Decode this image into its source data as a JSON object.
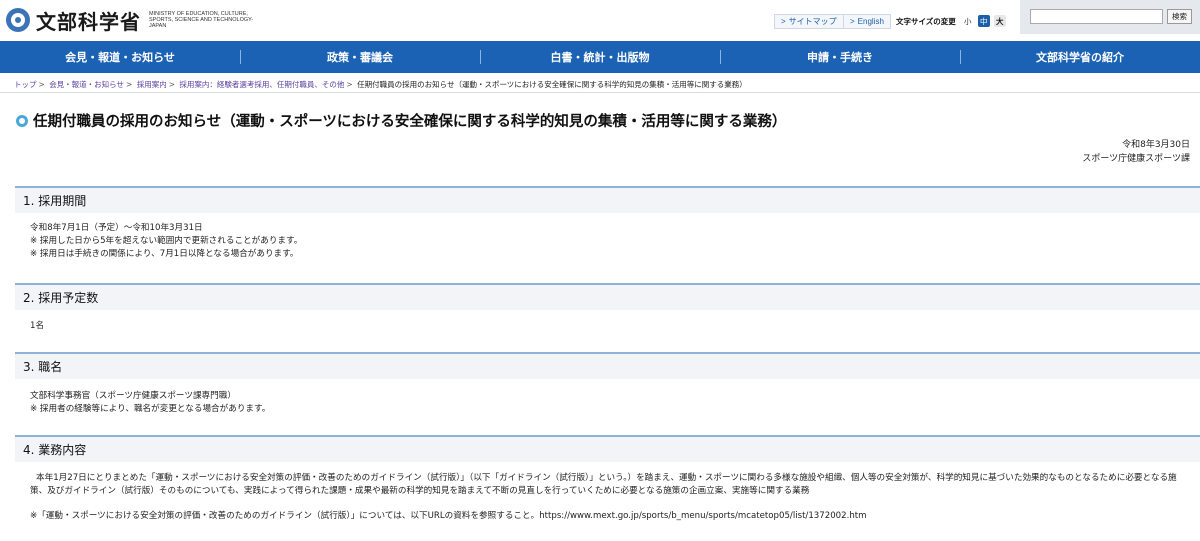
{
  "header": {
    "logo_text": "文部科学省",
    "logo_en": "MINISTRY OF EDUCATION, CULTURE, SPORTS, SCIENCE AND TECHNOLOGY-JAPAN",
    "sitemap_label": "サイトマップ",
    "english_label": "English",
    "fontsize_label": "文字サイズの変更",
    "fontsize_small": "小",
    "fontsize_mid": "中",
    "fontsize_big": "大",
    "search_placeholder": "",
    "search_button": "検索"
  },
  "nav": {
    "items": [
      {
        "label": "会見・報道・お知らせ"
      },
      {
        "label": "政策・審議会"
      },
      {
        "label": "白書・統計・出版物"
      },
      {
        "label": "申請・手続き"
      },
      {
        "label": "文部科学省の紹介"
      }
    ]
  },
  "breadcrumb": {
    "items": [
      {
        "label": "トップ"
      },
      {
        "label": "会見・報道・お知らせ"
      },
      {
        "label": "採用案内"
      },
      {
        "label": "採用案内：経験者選考採用、任期付職員、その他"
      }
    ],
    "current": "任期付職員の採用のお知らせ（運動・スポーツにおける安全確保に関する科学的知見の集積・活用等に関する業務）"
  },
  "page": {
    "title": "任期付職員の採用のお知らせ（運動・スポーツにおける安全確保に関する科学的知見の集積・活用等に関する業務）",
    "date": "令和8年3月30日",
    "department": "スポーツ庁健康スポーツ課"
  },
  "sections": [
    {
      "heading": "1. 採用期間",
      "lines": [
        "令和8年7月1日（予定）～令和10年3月31日",
        "※ 採用した日から5年を超えない範囲内で更新されることがあります。",
        "※ 採用日は手続きの関係により、7月1日以降となる場合があります。"
      ]
    },
    {
      "heading": "2. 採用予定数",
      "lines": [
        "1名"
      ]
    },
    {
      "heading": "3. 職名",
      "lines": [
        "文部科学事務官（スポーツ庁健康スポーツ課専門職）",
        "※ 採用者の経験等により、職名が変更となる場合があります。"
      ]
    },
    {
      "heading": "4. 業務内容",
      "paragraph": "本年1月27日にとりまとめた「運動・スポーツにおける安全対策の評価・改善のためのガイドライン（試行版）」（以下「ガイドライン（試行版）」という。）を踏まえ、運動・スポーツに関わる多様な施設や組織、個人等の安全対策が、科学的知見に基づいた効果的なものとなるために必要となる施策、及びガイドライン（試行版）そのものについても、実践によって得られた課題・成果や最新の科学的知見を踏まえて不断の見直しを行っていくために必要となる施策の企画立案、実施等に関する業務",
      "note": "※「運動・スポーツにおける安全対策の評価・改善のためのガイドライン（試行版）」については、以下URLの資料を参照すること。https://www.mext.go.jp/sports/b_menu/sports/mcatetop05/list/1372002.htm"
    }
  ]
}
